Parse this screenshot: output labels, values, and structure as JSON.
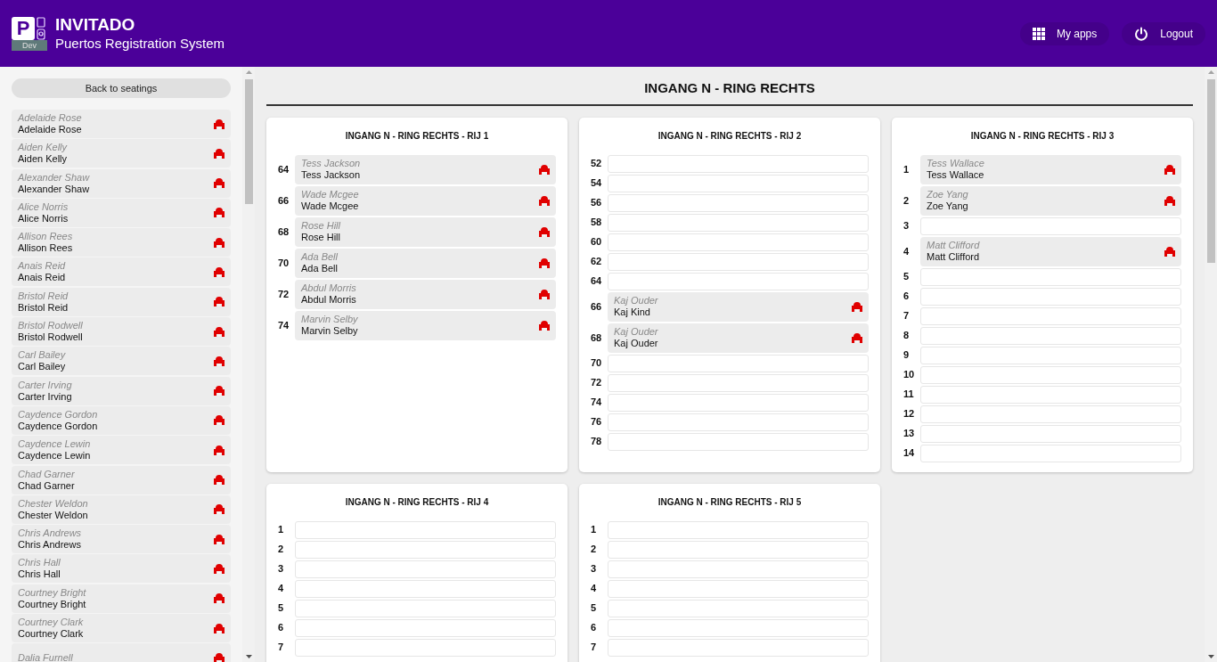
{
  "header": {
    "logo_letter": "P",
    "env_badge": "Dev",
    "title": "INVITADO",
    "subtitle": "Puertos Registration System",
    "actions": [
      {
        "kind": "apps",
        "label": "My apps"
      },
      {
        "kind": "power",
        "label": "Logout"
      }
    ]
  },
  "sidebar": {
    "back_button": "Back to seatings",
    "guests": [
      {
        "label": "Adelaide Rose",
        "name": "Adelaide Rose"
      },
      {
        "label": "Aiden Kelly",
        "name": "Aiden Kelly"
      },
      {
        "label": "Alexander Shaw",
        "name": "Alexander Shaw"
      },
      {
        "label": "Alice Norris",
        "name": "Alice Norris"
      },
      {
        "label": "Allison Rees",
        "name": "Allison Rees"
      },
      {
        "label": "Anais Reid",
        "name": "Anais Reid"
      },
      {
        "label": "Bristol Reid",
        "name": "Bristol Reid"
      },
      {
        "label": "Bristol Rodwell",
        "name": "Bristol Rodwell"
      },
      {
        "label": "Carl Bailey",
        "name": "Carl Bailey"
      },
      {
        "label": "Carter Irving",
        "name": "Carter Irving"
      },
      {
        "label": "Caydence Gordon",
        "name": "Caydence Gordon"
      },
      {
        "label": "Caydence Lewin",
        "name": "Caydence Lewin"
      },
      {
        "label": "Chad Garner",
        "name": "Chad Garner"
      },
      {
        "label": "Chester Weldon",
        "name": "Chester Weldon"
      },
      {
        "label": "Chris Andrews",
        "name": "Chris Andrews"
      },
      {
        "label": "Chris Hall",
        "name": "Chris Hall"
      },
      {
        "label": "Courtney Bright",
        "name": "Courtney Bright"
      },
      {
        "label": "Courtney Clark",
        "name": "Courtney Clark"
      },
      {
        "label": "Dalia Furnell"
      }
    ]
  },
  "section": {
    "title": "INGANG N - RING RECHTS",
    "rows": [
      {
        "title": "INGANG N - RING RECHTS - RIJ 1",
        "seats": [
          {
            "number": "64",
            "guest": {
              "label": "Tess Jackson",
              "name": "Tess Jackson"
            }
          },
          {
            "number": "66",
            "guest": {
              "label": "Wade Mcgee",
              "name": "Wade Mcgee"
            }
          },
          {
            "number": "68",
            "guest": {
              "label": "Rose Hill",
              "name": "Rose Hill"
            }
          },
          {
            "number": "70",
            "guest": {
              "label": "Ada Bell",
              "name": "Ada Bell"
            }
          },
          {
            "number": "72",
            "guest": {
              "label": "Abdul Morris",
              "name": "Abdul Morris"
            }
          },
          {
            "number": "74",
            "guest": {
              "label": "Marvin Selby",
              "name": "Marvin Selby"
            }
          }
        ]
      },
      {
        "title": "INGANG N - RING RECHTS - RIJ 2",
        "seats": [
          {
            "number": "52"
          },
          {
            "number": "54"
          },
          {
            "number": "56"
          },
          {
            "number": "58"
          },
          {
            "number": "60"
          },
          {
            "number": "62"
          },
          {
            "number": "64"
          },
          {
            "number": "66",
            "guest": {
              "label": "Kaj Ouder",
              "name": "Kaj Kind"
            }
          },
          {
            "number": "68",
            "guest": {
              "label": "Kaj Ouder",
              "name": "Kaj Ouder"
            }
          },
          {
            "number": "70"
          },
          {
            "number": "72"
          },
          {
            "number": "74"
          },
          {
            "number": "76"
          },
          {
            "number": "78"
          }
        ]
      },
      {
        "title": "INGANG N - RING RECHTS - RIJ 3",
        "seats": [
          {
            "number": "1",
            "guest": {
              "label": "Tess Wallace",
              "name": "Tess Wallace"
            }
          },
          {
            "number": "2",
            "guest": {
              "label": "Zoe Yang",
              "name": "Zoe Yang"
            }
          },
          {
            "number": "3"
          },
          {
            "number": "4",
            "guest": {
              "label": "Matt Clifford",
              "name": "Matt Clifford"
            }
          },
          {
            "number": "5"
          },
          {
            "number": "6"
          },
          {
            "number": "7"
          },
          {
            "number": "8"
          },
          {
            "number": "9"
          },
          {
            "number": "10"
          },
          {
            "number": "11"
          },
          {
            "number": "12"
          },
          {
            "number": "13"
          },
          {
            "number": "14"
          }
        ]
      },
      {
        "title": "INGANG N - RING RECHTS - RIJ 4",
        "seats": [
          {
            "number": "1"
          },
          {
            "number": "2"
          },
          {
            "number": "3"
          },
          {
            "number": "4"
          },
          {
            "number": "5"
          },
          {
            "number": "6"
          },
          {
            "number": "7"
          }
        ]
      },
      {
        "title": "INGANG N - RING RECHTS - RIJ 5",
        "seats": [
          {
            "number": "1"
          },
          {
            "number": "2"
          },
          {
            "number": "3"
          },
          {
            "number": "4"
          },
          {
            "number": "5"
          },
          {
            "number": "6"
          },
          {
            "number": "7"
          }
        ]
      }
    ]
  }
}
